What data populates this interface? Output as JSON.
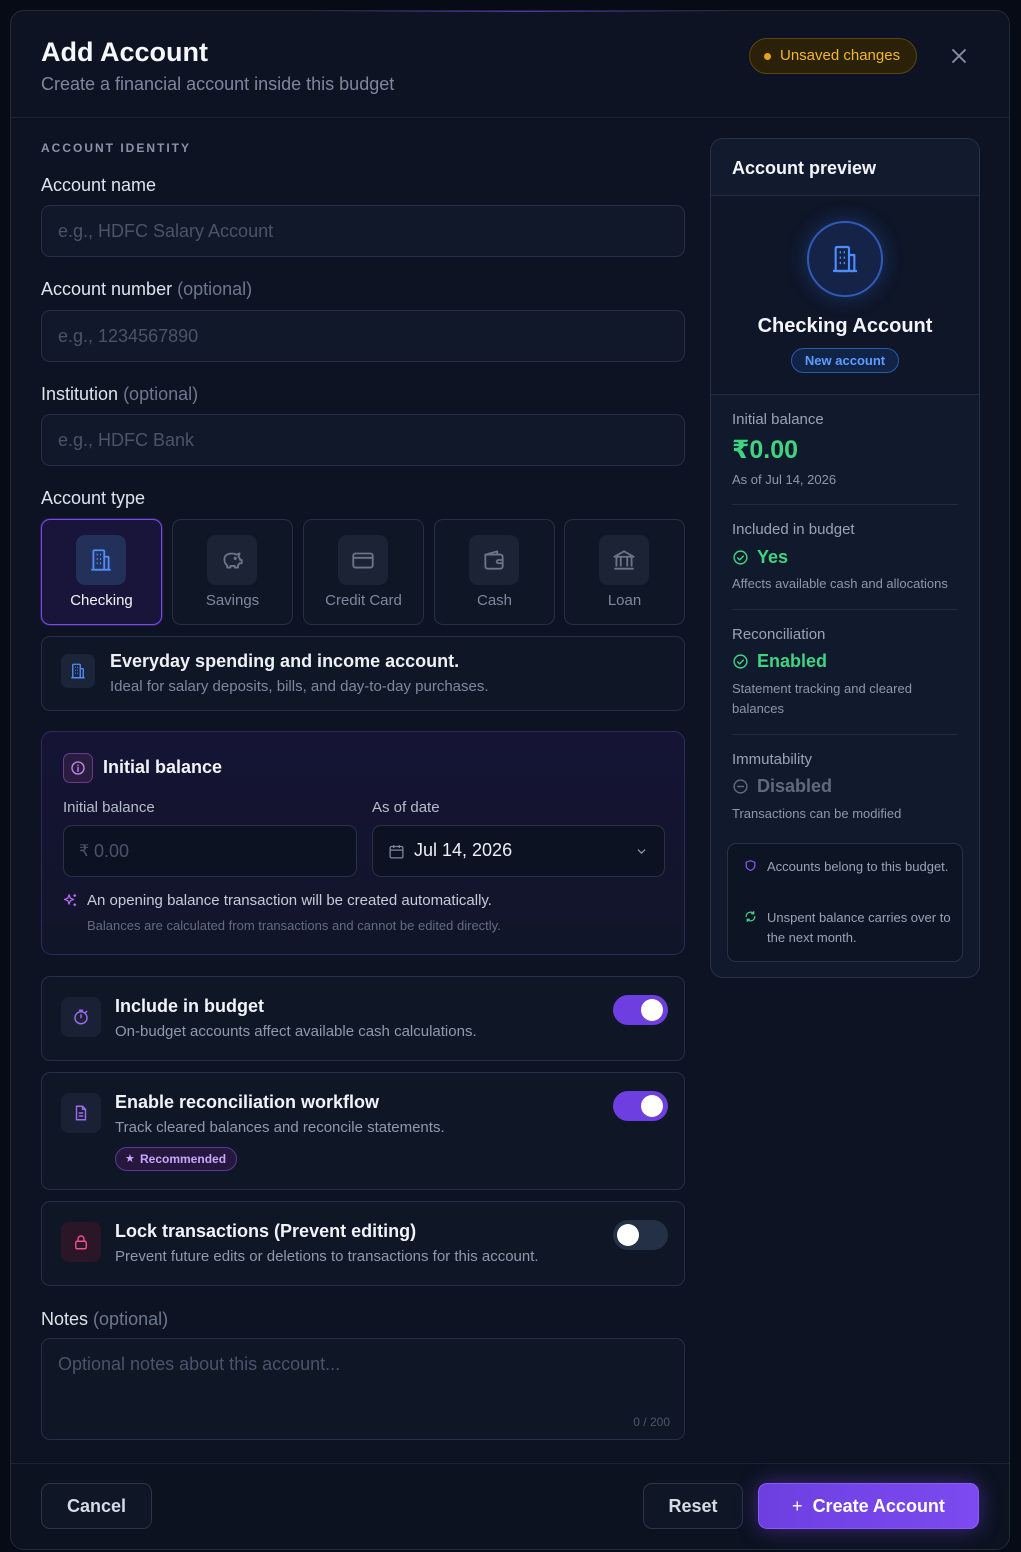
{
  "header": {
    "title": "Add Account",
    "subtitle": "Create a financial account inside this budget",
    "unsaved_badge": "Unsaved changes",
    "close_icon": "close-icon"
  },
  "identity": {
    "section_label": "ACCOUNT IDENTITY",
    "name_label": "Account name",
    "name_placeholder": "e.g., HDFC Salary Account",
    "number_label": "Account number",
    "number_optional": "(optional)",
    "number_placeholder": "e.g., 1234567890",
    "institution_label": "Institution",
    "institution_optional": "(optional)",
    "institution_placeholder": "e.g., HDFC Bank"
  },
  "account_type": {
    "label": "Account type",
    "selected": "Checking",
    "options": [
      {
        "label": "Checking",
        "icon": "building-icon"
      },
      {
        "label": "Savings",
        "icon": "piggy-bank-icon"
      },
      {
        "label": "Credit Card",
        "icon": "credit-card-icon"
      },
      {
        "label": "Cash",
        "icon": "wallet-icon"
      },
      {
        "label": "Loan",
        "icon": "bank-icon"
      }
    ],
    "description_title": "Everyday spending and income account.",
    "description_text": "Ideal for salary deposits, bills, and day-to-day purchases."
  },
  "initial_balance": {
    "heading": "Initial balance",
    "amount_label": "Initial balance",
    "currency_symbol": "₹",
    "amount_placeholder": "0.00",
    "date_label": "As of date",
    "date_value": "Jul 14, 2026",
    "note_primary": "An opening balance transaction will be created automatically.",
    "note_secondary": "Balances are calculated from transactions and cannot be edited directly."
  },
  "toggles": {
    "budget": {
      "title": "Include in budget",
      "description": "On-budget accounts affect available cash calculations.",
      "on": true
    },
    "reconcile": {
      "title": "Enable reconciliation workflow",
      "description": "Track cleared balances and reconcile statements.",
      "badge": "Recommended",
      "on": true
    },
    "lock": {
      "title": "Lock transactions (Prevent editing)",
      "description": "Prevent future edits or deletions to transactions for this account.",
      "on": false
    }
  },
  "notes": {
    "label": "Notes",
    "optional": "(optional)",
    "placeholder": "Optional notes about this account...",
    "counter": "0 / 200"
  },
  "preview": {
    "title": "Account preview",
    "account_name": "Checking Account",
    "badge": "New account",
    "balance_label": "Initial balance",
    "balance_value": "₹0.00",
    "balance_date": "As of Jul 14, 2026",
    "budget_label": "Included in budget",
    "budget_status": "Yes",
    "budget_note": "Affects available cash and allocations",
    "reconcile_label": "Reconciliation",
    "reconcile_status": "Enabled",
    "reconcile_note": "Statement tracking and cleared balances",
    "immutability_label": "Immutability",
    "immutability_status": "Disabled",
    "immutability_note": "Transactions can be modified",
    "info_1": "Accounts belong to this budget.",
    "info_2": "Unspent balance carries over to the next month."
  },
  "footer": {
    "cancel": "Cancel",
    "reset": "Reset",
    "create": "Create Account"
  },
  "colors": {
    "accent": "#7c4af0",
    "success": "#3fd47f",
    "warning": "#f5b72c",
    "info": "#5c9dff"
  }
}
